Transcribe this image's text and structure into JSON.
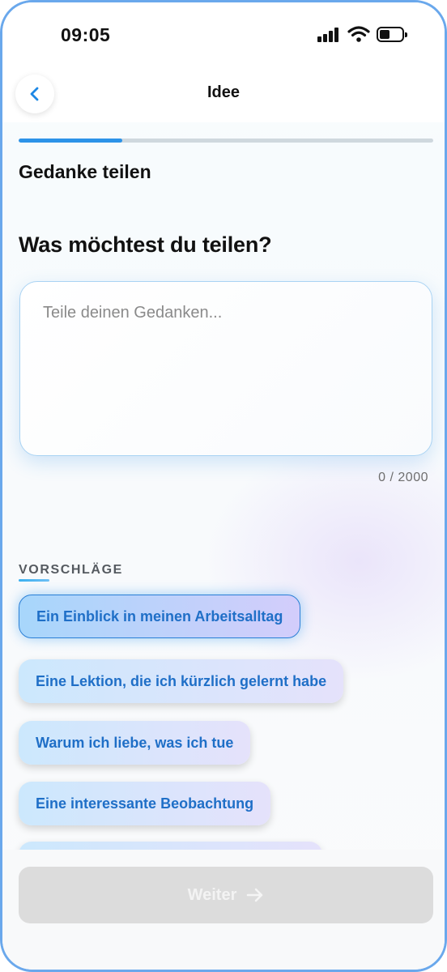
{
  "status_bar": {
    "time": "09:05",
    "battery_level": 0.4
  },
  "header": {
    "title": "Idee"
  },
  "progress": {
    "fraction": 0.25
  },
  "step": {
    "title": "Gedanke teilen"
  },
  "question": "Was möchtest du teilen?",
  "thought_input": {
    "placeholder": "Teile deinen Gedanken...",
    "value": "",
    "counter": "0 / 2000"
  },
  "suggestions": {
    "label": "VORSCHLÄGE",
    "items": [
      {
        "label": "Ein Einblick in meinen Arbeitsalltag",
        "selected": true
      },
      {
        "label": "Eine Lektion, die ich kürzlich gelernt habe",
        "selected": false
      },
      {
        "label": "Warum ich liebe, was ich tue",
        "selected": false
      },
      {
        "label": "Eine interessante Beobachtung",
        "selected": false
      }
    ]
  },
  "footer": {
    "next_label": "Weiter",
    "next_enabled": false
  },
  "colors": {
    "accent": "#2d93e8",
    "chip_text": "#1f6fc7",
    "frame": "#6aa8ec",
    "disabled_button": "#dcdcdc"
  }
}
